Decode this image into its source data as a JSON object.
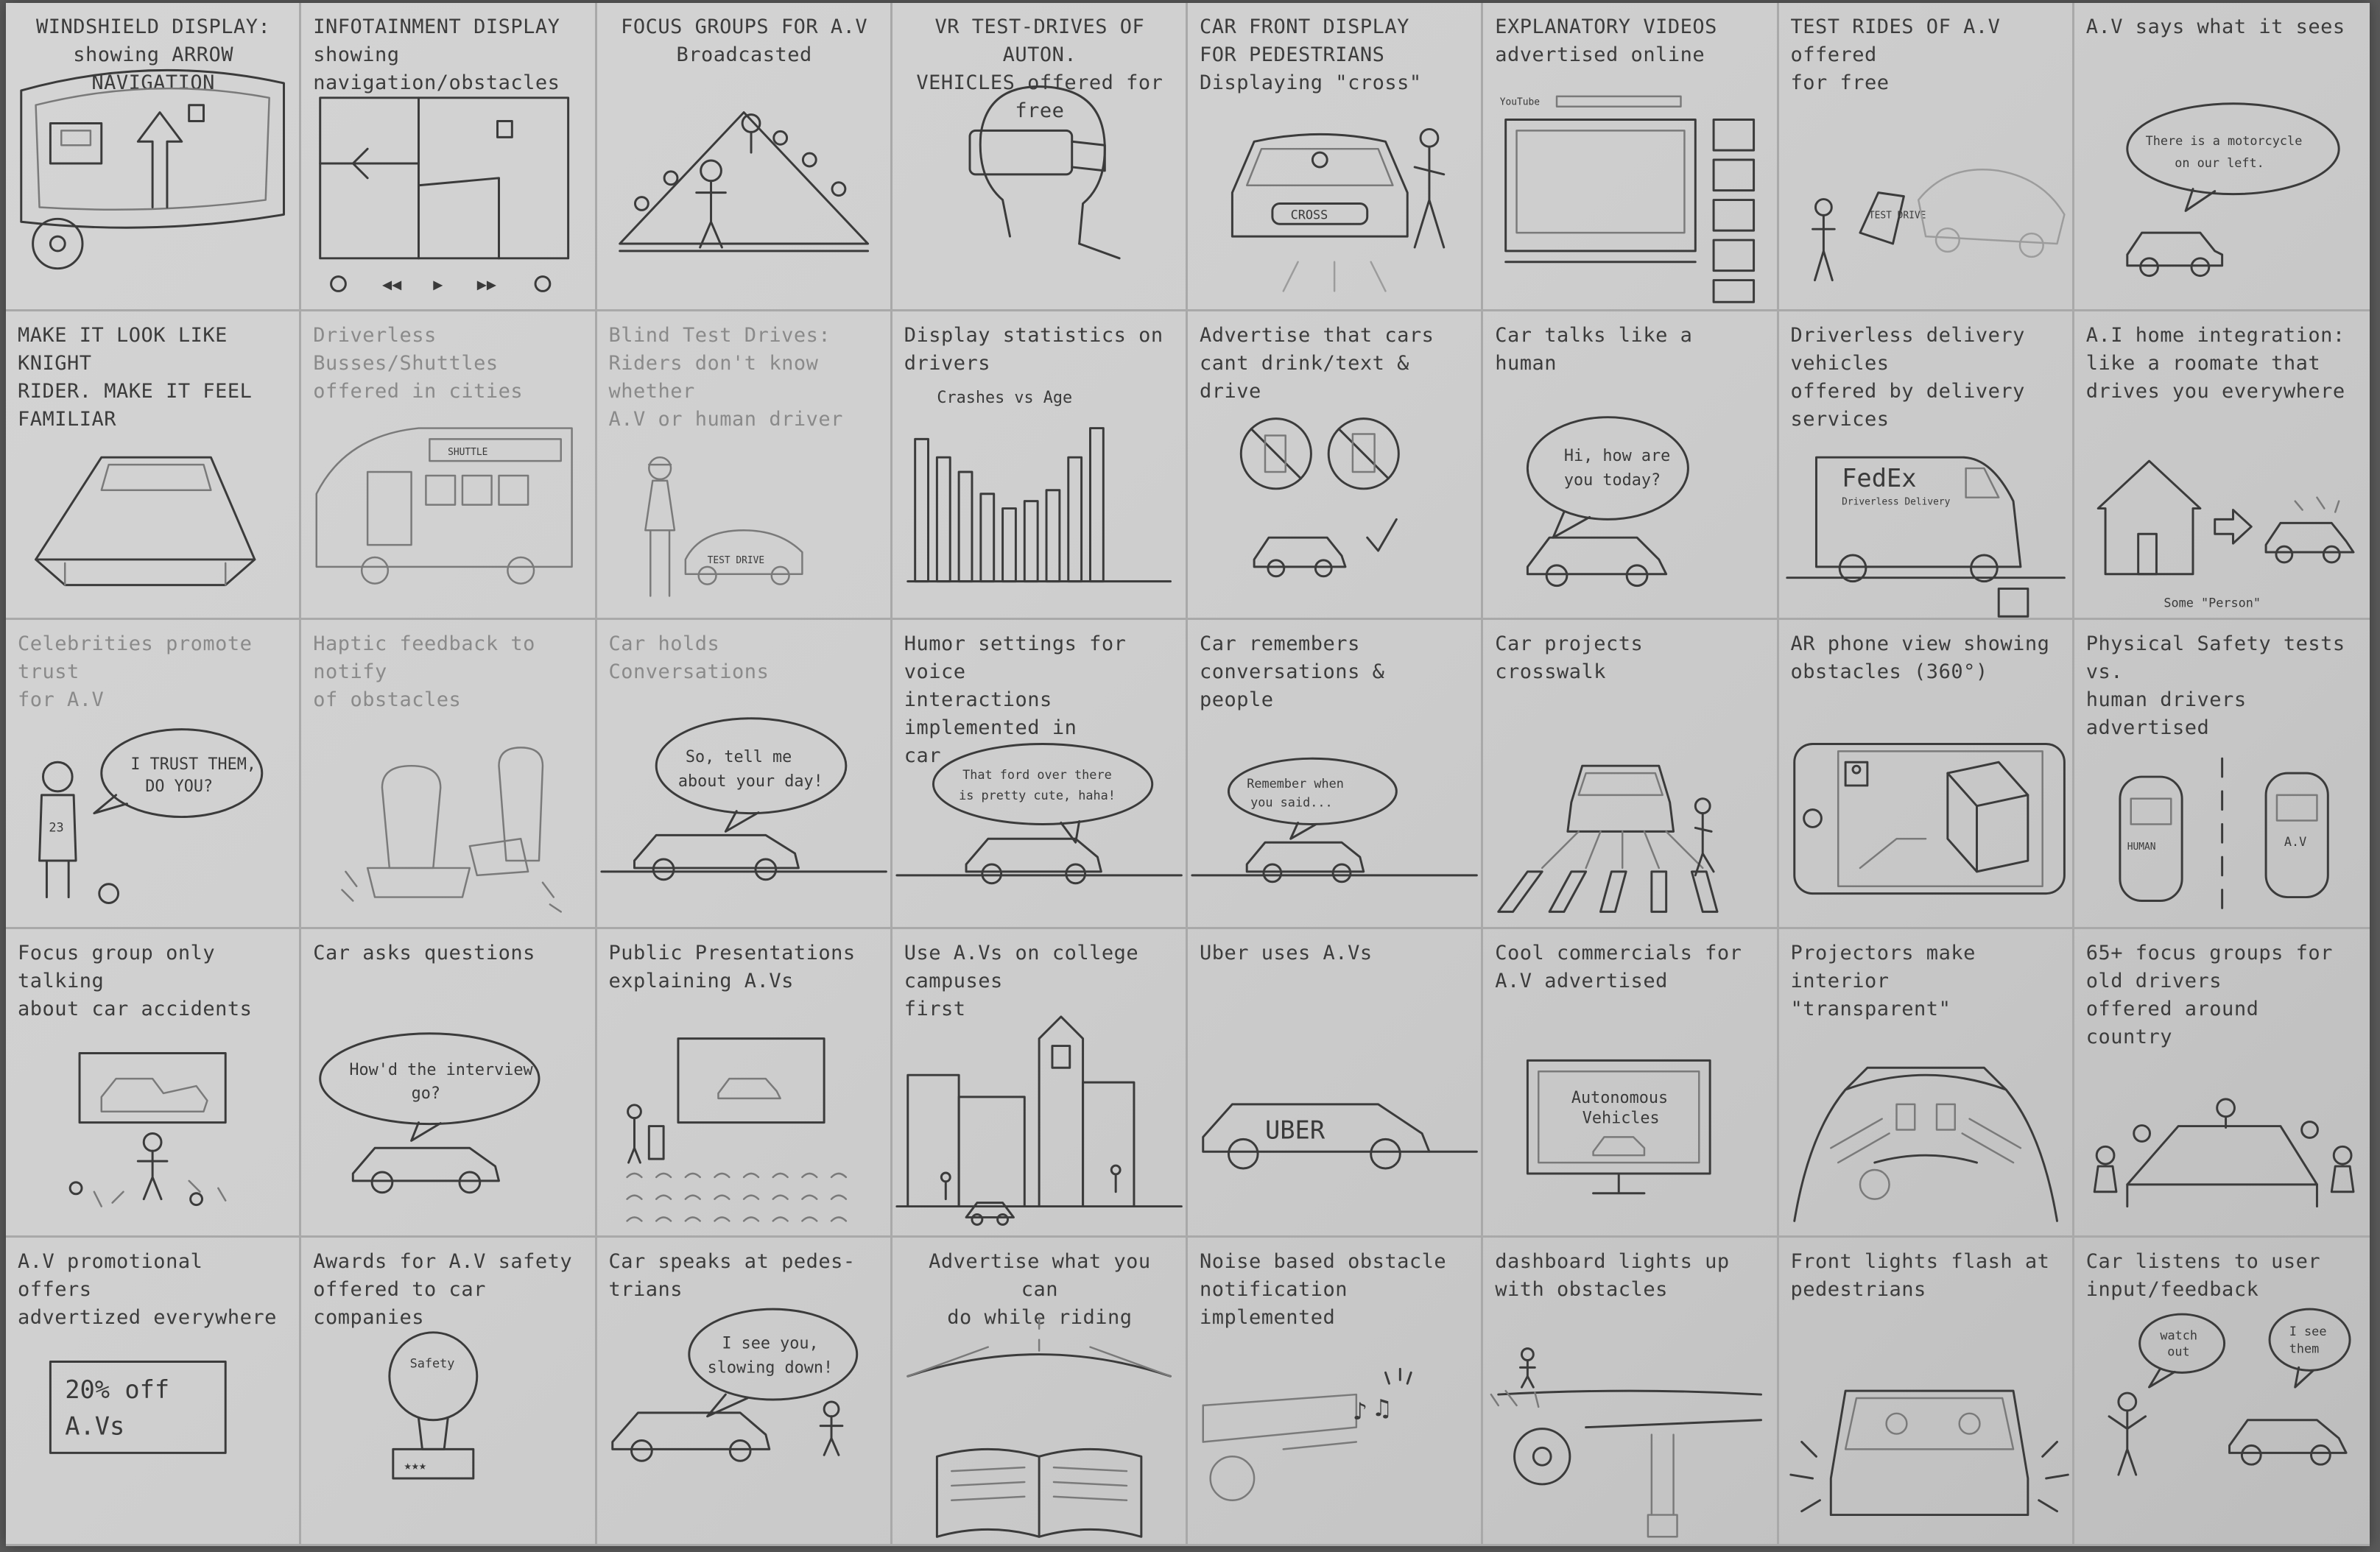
{
  "sheet": {
    "cells": [
      {
        "caption": "WINDSHIELD DISPLAY:\nshowing ARROW NAVIGATION",
        "style": "center"
      },
      {
        "caption": "INFOTAINMENT DISPLAY\nshowing navigation/obstacles"
      },
      {
        "caption": "FOCUS GROUPS FOR A.V\nBroadcasted",
        "style": "center"
      },
      {
        "caption": "VR TEST-DRIVES OF AUTON.\nVEHICLES offered for free",
        "style": "center"
      },
      {
        "caption": "CAR FRONT DISPLAY\nFOR PEDESTRIANS\nDisplaying \"cross\""
      },
      {
        "caption": "EXPLANATORY VIDEOS\nadvertised online"
      },
      {
        "caption": "TEST RIDES OF A.V offered\nfor free"
      },
      {
        "caption": "A.V says what it sees"
      },
      {
        "caption": "MAKE IT LOOK LIKE KNIGHT\nRIDER. MAKE IT FEEL FAMILIAR"
      },
      {
        "caption": "Driverless Busses/Shuttles\noffered in cities",
        "style": "faint"
      },
      {
        "caption": "Blind Test Drives:\nRiders don't know whether\nA.V or human driver",
        "style": "faint"
      },
      {
        "caption": "Display statistics on drivers"
      },
      {
        "caption": "Advertise that cars\ncant drink/text &\ndrive"
      },
      {
        "caption": "Car talks like a human"
      },
      {
        "caption": "Driverless delivery vehicles\noffered by delivery services"
      },
      {
        "caption": "A.I home integration:\nlike a roomate that\ndrives you everywhere"
      },
      {
        "caption": "Celebrities promote trust\nfor A.V",
        "style": "faint"
      },
      {
        "caption": "Haptic feedback to notify\nof obstacles",
        "style": "faint"
      },
      {
        "caption": "Car holds Conversations",
        "style": "faint"
      },
      {
        "caption": "Humor settings for voice\ninteractions implemented in\ncar"
      },
      {
        "caption": "Car remembers\nconversations &\npeople"
      },
      {
        "caption": "Car projects crosswalk"
      },
      {
        "caption": "AR phone view showing\nobstacles (360°)"
      },
      {
        "caption": "Physical Safety tests\nvs.\nhuman drivers\nadvertised"
      },
      {
        "caption": "Focus group only talking\nabout car accidents"
      },
      {
        "caption": "Car asks questions"
      },
      {
        "caption": "Public Presentations\nexplaining A.Vs"
      },
      {
        "caption": "Use A.Vs on college campuses\nfirst"
      },
      {
        "caption": "Uber uses A.Vs"
      },
      {
        "caption": "Cool commercials for\nA.V advertised"
      },
      {
        "caption": "Projectors make interior\n\"transparent\""
      },
      {
        "caption": "65+ focus groups for\nold drivers\noffered around\ncountry"
      },
      {
        "caption": "A.V promotional offers\nadvertized everywhere"
      },
      {
        "caption": "Awards for A.V safety\noffered to car companies"
      },
      {
        "caption": "Car speaks at pedes-\ntrians"
      },
      {
        "caption": "Advertise what you can\ndo while riding"
      },
      {
        "caption": "Noise based obstacle\nnotification implemented"
      },
      {
        "caption": "dashboard lights up\nwith obstacles"
      },
      {
        "caption": "Front lights flash at pedestrians"
      },
      {
        "caption": "Car listens to user\ninput/feedback"
      }
    ]
  },
  "sketch_text": {
    "av_sees_bubble_1": "There is a motorcycle",
    "av_sees_bubble_2": "on our left.",
    "talks_bubble_1": "Hi, how are",
    "talks_bubble_2": "you today?",
    "holds_bubble_1": "So, tell me",
    "holds_bubble_2": "about your day!",
    "humor_bubble_1": "That ford over there",
    "humor_bubble_2": "is pretty cute, haha!",
    "remembers_bubble_1": "Remember when",
    "remembers_bubble_2": "you said...",
    "celebrity_bubble_1": "I TRUST THEM,",
    "celebrity_bubble_2": "DO YOU?",
    "asks_bubble_1": "How'd the interview",
    "asks_bubble_2": "go?",
    "speaks_bubble_1": "I see you,",
    "speaks_bubble_2": "slowing down!",
    "listens_bubble_1a": "watch",
    "listens_bubble_1b": "out",
    "listens_bubble_2a": "I see",
    "listens_bubble_2b": "them",
    "cross_plate": "CROSS",
    "test_drive_sign": "TEST DRIVE",
    "blind_test_car": "TEST DRIVE",
    "stats_title": "Crashes vs Age",
    "fedex_logo": "FedEx",
    "fedex_sub": "Driverless Delivery",
    "home_caption": "Some \"Person\"",
    "uber_label": "UBER",
    "commercial_1": "Autonomous",
    "commercial_2": "Vehicles",
    "promo_1": "20% off",
    "promo_2": "A.Vs",
    "award_text": "Safety",
    "human_label": "HUMAN",
    "av_label": "A.V",
    "shuttle_sign": "SHUTTLE",
    "jersey_number": "23",
    "youtube_logo": "YouTube"
  }
}
